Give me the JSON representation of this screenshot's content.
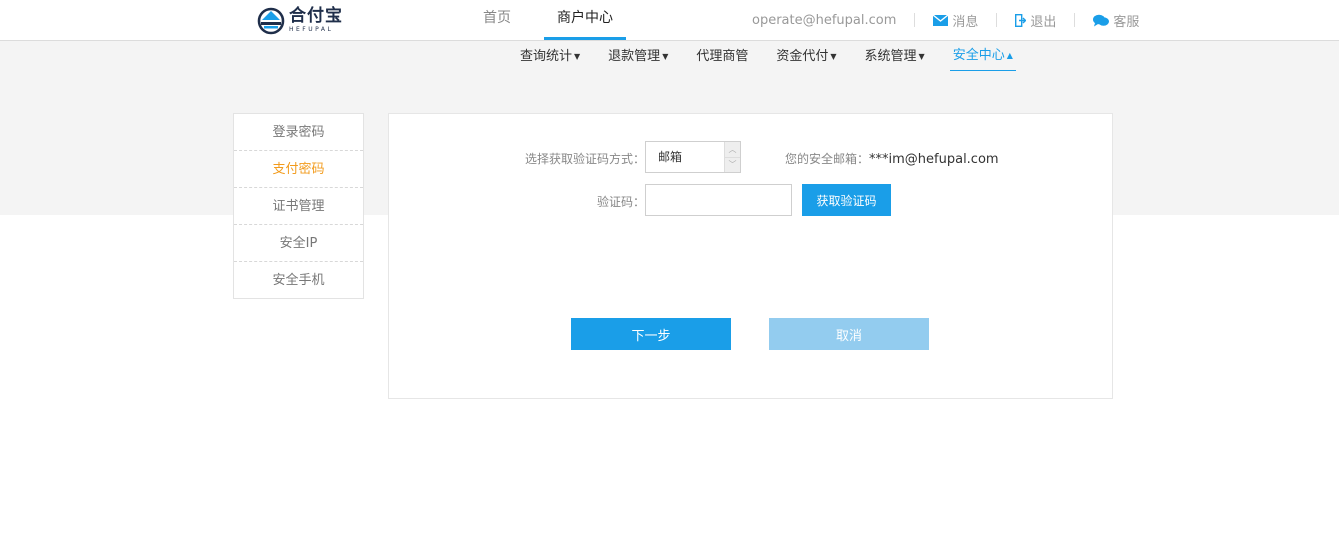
{
  "brand": {
    "name_cn": "合付宝",
    "name_en": "HEFUPAL",
    "primary_color": "#1a9ee8",
    "accent_color": "#f29b1c"
  },
  "main_nav": {
    "home": "首页",
    "merchant_center": "商户中心"
  },
  "user_area": {
    "email": "operate@hefupal.com",
    "messages": "消息",
    "logout": "退出",
    "service": "客服"
  },
  "sub_nav": {
    "query_stats": "查询统计",
    "refund_mgmt": "退款管理",
    "agent_mgmt": "代理商管",
    "fund_payment": "资金代付",
    "system_mgmt": "系统管理",
    "security_center": "安全中心"
  },
  "sidebar": {
    "items": [
      {
        "label": "登录密码"
      },
      {
        "label": "支付密码"
      },
      {
        "label": "证书管理"
      },
      {
        "label": "安全IP"
      },
      {
        "label": "安全手机"
      }
    ]
  },
  "form": {
    "method_label": "选择获取验证码方式：",
    "method_value": "邮箱",
    "safe_email_label": "您的安全邮箱：",
    "safe_email_value": "***im@hefupal.com",
    "code_label": "验证码：",
    "code_value": "",
    "get_code_button": "获取验证码",
    "next_button": "下一步",
    "cancel_button": "取消"
  }
}
